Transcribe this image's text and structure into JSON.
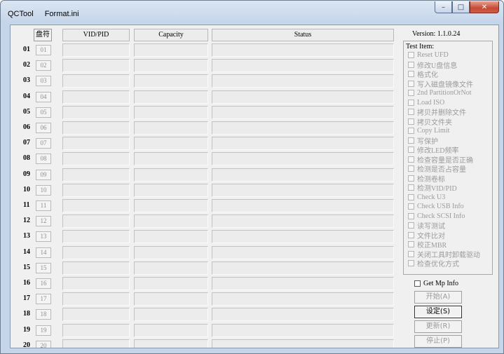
{
  "window": {
    "title": "QCTool",
    "subtitle": "Format.ini",
    "buttons": {
      "minimize": "–",
      "maximize": "□",
      "close": "✕"
    }
  },
  "table": {
    "headers": {
      "drive": "盘符",
      "vidpid": "VID/PID",
      "capacity": "Capacity",
      "status": "Status"
    },
    "rows": [
      {
        "num": "01",
        "port": "01"
      },
      {
        "num": "02",
        "port": "02"
      },
      {
        "num": "03",
        "port": "03"
      },
      {
        "num": "04",
        "port": "04"
      },
      {
        "num": "05",
        "port": "05"
      },
      {
        "num": "06",
        "port": "06"
      },
      {
        "num": "07",
        "port": "07"
      },
      {
        "num": "08",
        "port": "08"
      },
      {
        "num": "09",
        "port": "09"
      },
      {
        "num": "10",
        "port": "10"
      },
      {
        "num": "11",
        "port": "11"
      },
      {
        "num": "12",
        "port": "12"
      },
      {
        "num": "13",
        "port": "13"
      },
      {
        "num": "14",
        "port": "14"
      },
      {
        "num": "15",
        "port": "15"
      },
      {
        "num": "16",
        "port": "16"
      },
      {
        "num": "17",
        "port": "17"
      },
      {
        "num": "18",
        "port": "18"
      },
      {
        "num": "19",
        "port": "19"
      },
      {
        "num": "20",
        "port": "20"
      }
    ]
  },
  "side": {
    "version": "Version: 1.1.0.24",
    "test_item_label": "Test Item:",
    "test_items": [
      "Reset UFD",
      "修改U盘信息",
      "格式化",
      "写入磁盘镜像文件",
      "2nd PartitionOrNot",
      "Load ISO",
      "拷贝并删除文件",
      "拷贝文件夹",
      "Copy Limit",
      "写保护",
      "修改LED频率",
      "检查容量是否正确",
      "检测是否占容量",
      "检测卷标",
      "检测VID/PID",
      "Check U3",
      "Check USB Info",
      "Check SCSI Info",
      "读写测试",
      "文件比对",
      "校正MBR",
      "关闭工具时卸载驱动",
      "检查优化方式"
    ],
    "get_mp_info": "Get Mp Info",
    "buttons": {
      "start": "开始(A)",
      "settings": "设定(S)",
      "update": "更新(R)",
      "stop": "停止(P)"
    }
  },
  "icons": {
    "minimize": "minimize-icon",
    "maximize": "maximize-icon",
    "close": "close-icon"
  }
}
